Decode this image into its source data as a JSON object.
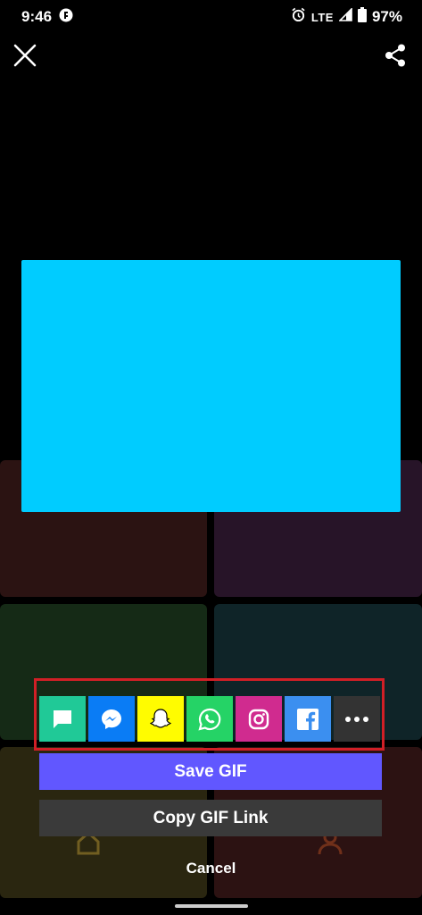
{
  "status_bar": {
    "time": "9:46",
    "network": "LTE",
    "battery": "97%"
  },
  "toolbar": {
    "close_icon": "close-icon",
    "share_icon": "share-icon"
  },
  "preview": {
    "color": "#00ccff"
  },
  "share_apps": [
    {
      "name": "messages",
      "color": "#20c997"
    },
    {
      "name": "messenger",
      "color": "#0a7cf5"
    },
    {
      "name": "snapchat",
      "color": "#fffc00"
    },
    {
      "name": "whatsapp",
      "color": "#25d366"
    },
    {
      "name": "instagram",
      "color": "#d02b8f"
    },
    {
      "name": "facebook",
      "color": "#3b8ff0"
    },
    {
      "name": "more",
      "color": "#333333"
    }
  ],
  "actions": {
    "save_label": "Save GIF",
    "copy_label": "Copy GIF Link",
    "cancel_label": "Cancel"
  },
  "colors": {
    "save_button": "#6157ff",
    "copy_button": "#3a3a3a",
    "highlight_box": "#d11f26"
  }
}
